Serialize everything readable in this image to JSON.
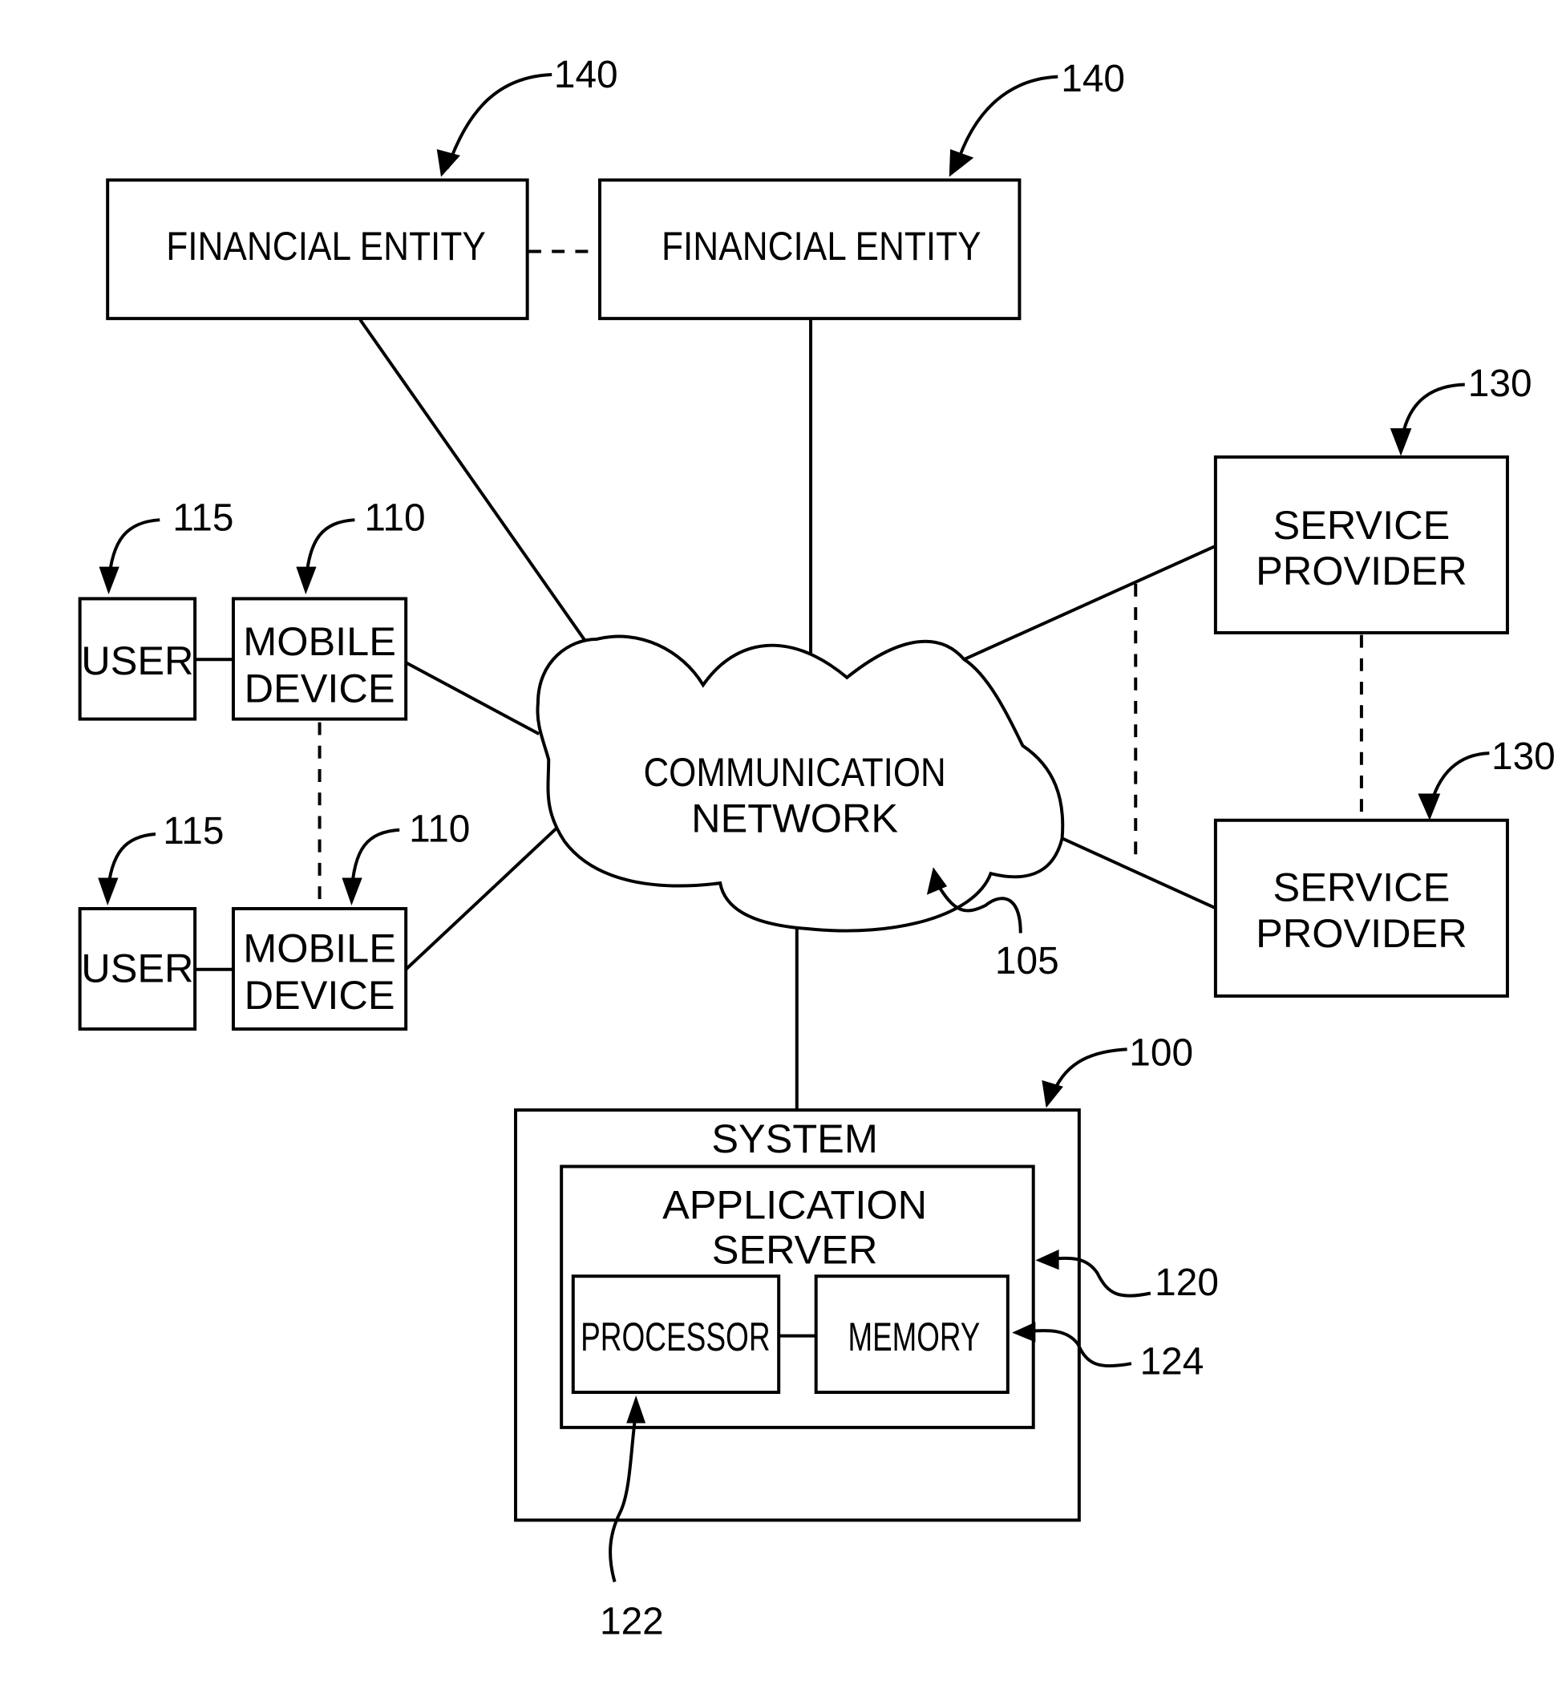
{
  "diagram": {
    "financial_entities": [
      {
        "label": "FINANCIAL ENTITY",
        "ref": "140"
      },
      {
        "label": "FINANCIAL ENTITY",
        "ref": "140"
      }
    ],
    "service_providers": [
      {
        "line1": "SERVICE",
        "line2": "PROVIDER",
        "ref": "130"
      },
      {
        "line1": "SERVICE",
        "line2": "PROVIDER",
        "ref": "130"
      }
    ],
    "users": [
      {
        "label": "USER",
        "ref": "115"
      },
      {
        "label": "USER",
        "ref": "115"
      }
    ],
    "mobile_devices": [
      {
        "line1": "MOBILE",
        "line2": "DEVICE",
        "ref": "110"
      },
      {
        "line1": "MOBILE",
        "line2": "DEVICE",
        "ref": "110"
      }
    ],
    "network": {
      "line1": "COMMUNICATION",
      "line2": "NETWORK",
      "ref": "105"
    },
    "system": {
      "label": "SYSTEM",
      "ref": "100",
      "application_server": {
        "line1": "APPLICATION",
        "line2": "SERVER",
        "ref": "120"
      },
      "processor": {
        "label": "PROCESSOR",
        "ref": "122"
      },
      "memory": {
        "label": "MEMORY",
        "ref": "124"
      }
    }
  }
}
